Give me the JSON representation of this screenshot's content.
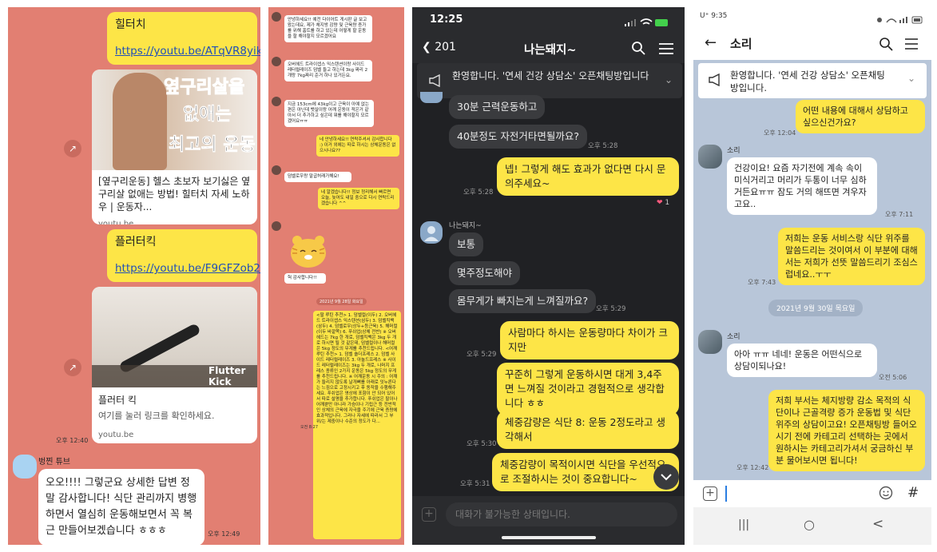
{
  "panel1": {
    "bubble1_title": "힐터치",
    "bubble1_link": "https://youtu.be/ATqVR8yikQg",
    "card1": {
      "thumb_line1": "옆구리살을",
      "thumb_line2": "없애는",
      "thumb_line3": "최고의 운동",
      "title": "[옆구리운동] 헬스 초보자 보기싫은 옆구리살 없애는 방법! 힐터치 자세 노하우 | 운동자...",
      "domain": "youtu.be"
    },
    "bubble2_title": "플러터킥",
    "bubble2_link": "https://youtu.be/F9GFZob2_xA",
    "card2": {
      "thumb_label": "Flutter Kick",
      "title": "플러터 킥",
      "desc": "여기를 눌러 링크를 확인하세요.",
      "domain": "youtu.be"
    },
    "time1": "오후 12:40",
    "sender": "벙찐 튜브",
    "reply": "오오!!!! 그렇군요 상세한 답변 정말 감사합니다! 식단 관리까지 병행하면서 열심히 운동해보면서 꼭 복근 만들어보겠습니다 ㅎㅎㅎ",
    "time2": "오후 12:49"
  },
  "panel2": {
    "messages": [
      "안녕하세요!! 예전 다이어트 게시판 글 보고 왔는데요, 제가 체지방 감량 및 근육량 증가를 위해 홈트를 하고 있는데 어떻게 할 운동을 할 해야할지 모르겠어요",
      "오버헤드 트라이셉스 익스텐션이랑 사이드 레터럴레이즈 덤벨 들고 하는데 3kg 짜리 2개랑 7kg짜리 준거 하나 있거든요.",
      "지금 153cm에 43kg이고 근육이 아예 없는 편은 아닌데 뱃살이랑 어깨 운동이 적은거 같아서 더 추가하고 싶은데 뭐를 해야할지 모르겠어요ㅠㅠ",
      "네 안녕하세요!! 연락주셔서 감사합니다 :) 이거 외에는 따로 하시는 상체운동은 없으시나요??",
      "덤벨로우랑 말굽허래가해요!",
      "네 알겠습니다!! 정보 정리해서 빠르면 오늘, 늦어도 내일 중으로 다시 연락드리겠습니다 ^^",
      "헉 감사합니다!!",
      "2021년 9월 28일 화요일",
      "<팔 루틴 추천> 1. 덤벨컬(이두) 2. 오버헤드 트라이셉스 익스텐션(삼두) 3. 덤벨킥백(삼두) 4. 덤벨로우(상두+등근육) 5. 해머컬(이두 바깥쪽) 6. 푸쉬업(상체 전반) ※ 오버헤드는 7kg 한 개로, 덤벨킥백은 3kg 두 개로 하시면 될 것 같은데, 덤벨컬이나 해머컬은 5kg 정도의 무게를 추천드립니다. <어깨 루틴 추천> 1. 덤벨 숄더프레스 2. 덤벨 사이드 레터럴레이즈 3. 아놀드프레스 ※ 사이드 레터럴레이즈는 3kg 두 개로, 나머지 프레스 종류인 2가지 운동은 5kg 정도의 무게를 추천드립니다. ※ 어깨운동 시 주의 : 어깨가 들리지 않도록 날개뼈를 아래로 잇누른다는 느낌으로 고정시키고 후 동작을 수행해주세요. 푸쉬업은 영상에 포함이 안 되어 있어서 따로 설명을 추가합니다. 푸쉬업은 팔이나 어깨뿐만 아니라 가슴이나 기립근 등 전반적인 상체의 근육에 자극을 주기에 근육 증량에 효과적입니다. 그러나 자세에 따라서 그 부위/는 제중이나 수준의 정도가 다...",
      "오전 8:27"
    ]
  },
  "panel3": {
    "status_time": "12:25",
    "back_label": "201",
    "title": "나는돼지~",
    "notice": "환영합니다. '연세 건강 상담소' 오픈채팅방입니다",
    "messages": [
      {
        "side": "left",
        "text": "30분 근력운동하고"
      },
      {
        "side": "left",
        "text": "40분정도 자전거타면될까요?"
      },
      {
        "side": "time",
        "text": "오후 5:28"
      },
      {
        "side": "right",
        "text": "넵! 그렇게 해도 효과가 없다면 다시 문의주세요~"
      },
      {
        "side": "time",
        "text": "오후 5:28"
      },
      {
        "side": "reaction",
        "text": "1"
      },
      {
        "side": "name",
        "text": "나는돼지~"
      },
      {
        "side": "left",
        "text": "보통"
      },
      {
        "side": "left",
        "text": "몇주정도해야"
      },
      {
        "side": "left",
        "text": "몸무게가 빠지는게 느껴질까요?"
      },
      {
        "side": "time",
        "text": "오후 5:29"
      },
      {
        "side": "right",
        "text": "사람마다 하시는 운동량마다 차이가 크지만"
      },
      {
        "side": "time",
        "text": "오후 5:29"
      },
      {
        "side": "right",
        "text": "꾸준히 그렇게 운동하시면 대게 3,4주면 느껴질 것이라고 경험적으로 생각합니다 ㅎㅎ"
      },
      {
        "side": "right",
        "text": "체중감량은 식단 8: 운동 2정도라고 생각해서"
      },
      {
        "side": "time",
        "text": "오후 5:30"
      },
      {
        "side": "right",
        "text": "체중감량이 목적이시면 식단을 우선적으로 조절하시는 것이 중요합니다~"
      },
      {
        "side": "time",
        "text": "오후 5:31"
      }
    ],
    "input_placeholder": "대화가 불가능한 상태입니다."
  },
  "panel4": {
    "status_time": "U⁺ 9:35",
    "title": "소리",
    "notice": "환영합니다. '연세 건강 상담소' 오픈채팅방입니다.",
    "q1": "어떤 내용에 대해서 상담하고 싶으신건가요?",
    "q1_time": "오후 12:04",
    "sender": "소리",
    "a1": "건강이요! 요즘 자기전에 계속 속이 미식거리고 머리가 두통이 너무 심하거든요ㅠㅠ 잠도 거의 해뜨면 겨우자고요..",
    "a1_time": "오후 7:11",
    "r1": "저희는 운동 서비스랑 식단 위주를 말씀드리는 것이여서 이 부분에 대해서는 저희가 선뜻 말씀드리기 조심스럽네요..ㅜㅜ",
    "r1_time": "오후 7:43",
    "date": "2021년 9월 30일 목요일",
    "a2": "아아 ㅠㅠ 네네! 운동은 어떤식으로 상담이되나요!",
    "a2_time": "오전 5:06",
    "r2": "저희 부서는 체지방량 감소 목적의 식단이나 근골격량 증가 운동법 및 식단 위주의 상담이고요! 오픈채팅방 들어오시기 전에 카테고리 선택하는 곳에서 원하시는 카테고리가셔서 궁금하신 부분 물어보시면 됩니다!",
    "r2_time": "오후 12:42",
    "hash": "#",
    "nav": [
      "|||",
      "○",
      "<"
    ]
  }
}
